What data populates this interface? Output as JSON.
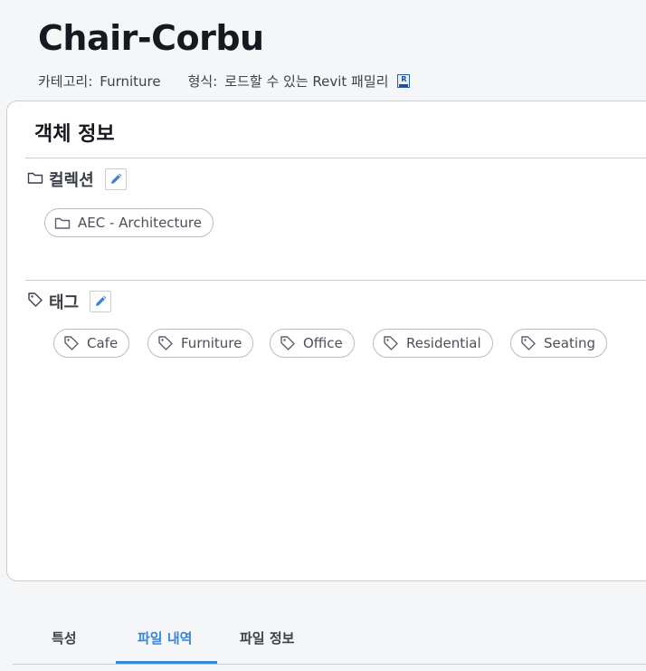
{
  "header": {
    "title": "Chair-Corbu",
    "category_key": "카테고리:",
    "category_value": "Furniture",
    "format_key": "형식:",
    "format_value": "로드할 수 있는 Revit 패밀리",
    "format_icon": "revit-file-icon",
    "format_icon_text": "R"
  },
  "card": {
    "title": "객체 정보",
    "collections": {
      "label": "컬렉션",
      "icon": "folder-icon",
      "items": [
        "AEC - Architecture"
      ]
    },
    "tags": {
      "label": "태그",
      "icon": "tag-icon",
      "items": [
        "Cafe",
        "Furniture",
        "Office",
        "Residential",
        "Seating"
      ]
    }
  },
  "tabs": [
    {
      "label": "특성",
      "active": false
    },
    {
      "label": "파일 내역",
      "active": true
    },
    {
      "label": "파일 정보",
      "active": false
    }
  ],
  "colors": {
    "accent": "#3a85d8",
    "border": "#c9cdd3",
    "background": "#f5f6f8"
  }
}
